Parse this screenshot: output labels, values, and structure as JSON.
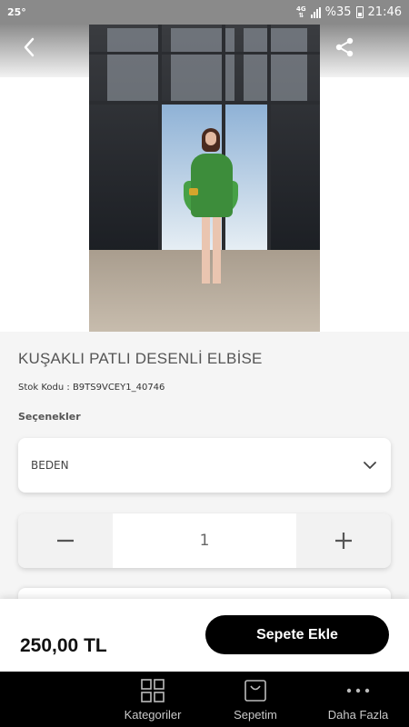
{
  "status_bar": {
    "temperature": "25°",
    "network": "4G",
    "battery": "%35",
    "time": "21:46"
  },
  "header": {
    "back_icon": "chevron-left-icon",
    "share_icon": "share-icon"
  },
  "product": {
    "title": "KUŞAKLI PATLI DESENLİ ELBİSE",
    "stock_code": "Stok Kodu : B9TS9VCEY1_40746",
    "options_label": "Seçenekler",
    "size_select": {
      "value": "BEDEN",
      "icon": "chevron-down-icon"
    },
    "quantity": {
      "value": "1",
      "decrement_icon": "minus-icon",
      "increment_icon": "plus-icon"
    }
  },
  "footer": {
    "price": "250,00 TL",
    "add_to_cart_label": "Sepete Ekle"
  },
  "bottom_nav": {
    "items": [
      {
        "label": "Kategoriler",
        "icon": "grid-icon"
      },
      {
        "label": "Sepetim",
        "icon": "shopping-bag-icon"
      },
      {
        "label": "Daha Fazla",
        "icon": "more-dots-icon"
      }
    ]
  },
  "colors": {
    "accent": "#000000",
    "background": "#f5f5f5",
    "status_bar": "#8a8a8a"
  }
}
